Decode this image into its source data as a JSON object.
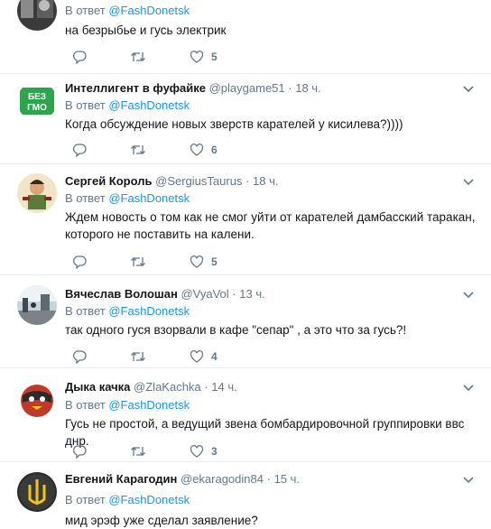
{
  "reply_prefix": "В ответ",
  "tweets": [
    {
      "name": "",
      "handle": "",
      "time": "",
      "reply_to": "@FashDonetsk",
      "text": "на безрыбье и гусь электрик",
      "likes": "5",
      "avatar": "dark-photo"
    },
    {
      "name": "Интеллигент в фуфайке",
      "handle": "@playgame51",
      "time": "18 ч.",
      "reply_to": "@FashDonetsk",
      "text": "Когда обсуждение новых зверств карателей у кисилева?))))",
      "likes": "6",
      "avatar": "bez-gmo",
      "avatar_text_top": "БЕЗ",
      "avatar_text_bottom": "ГМО"
    },
    {
      "name": "Сергей Король",
      "handle": "@SergiusTaurus",
      "time": "18 ч.",
      "reply_to": "@FashDonetsk",
      "text": "Ждем новость о том как не смог уйти от карателей дамбасский таракан, которого не поставить на калени.",
      "likes": "5",
      "avatar": "cossack-illustration"
    },
    {
      "name": "Вячеслав Волошан",
      "handle": "@VyaVol",
      "time": "13 ч.",
      "reply_to": "@FashDonetsk",
      "text": "так одного гуся взорвали в кафе \"сепар\" , а это что за гусь?!",
      "likes": "4",
      "avatar": "street-photo"
    },
    {
      "name": "Дыка качка",
      "handle": "@ZlaKachka",
      "time": "14 ч.",
      "reply_to": "@FashDonetsk",
      "text": "Гусь не простой, а ведущий звена бомбардировочной группировки ввс днр.",
      "likes": "3",
      "avatar": "angry-bird"
    },
    {
      "name": "Евгений Карагодин",
      "handle": "@ekaragodin84",
      "time": "15 ч.",
      "reply_to": "@FashDonetsk",
      "text": "мид эрэф уже сделал заявление?",
      "likes": "",
      "avatar": "trident"
    }
  ],
  "colors": {
    "name": "#14171a",
    "secondary": "#657786",
    "link": "#1b95e0",
    "divider": "#e6ecf0"
  },
  "icons": [
    "reply-icon",
    "retweet-icon",
    "like-icon",
    "chevron-down-icon"
  ]
}
